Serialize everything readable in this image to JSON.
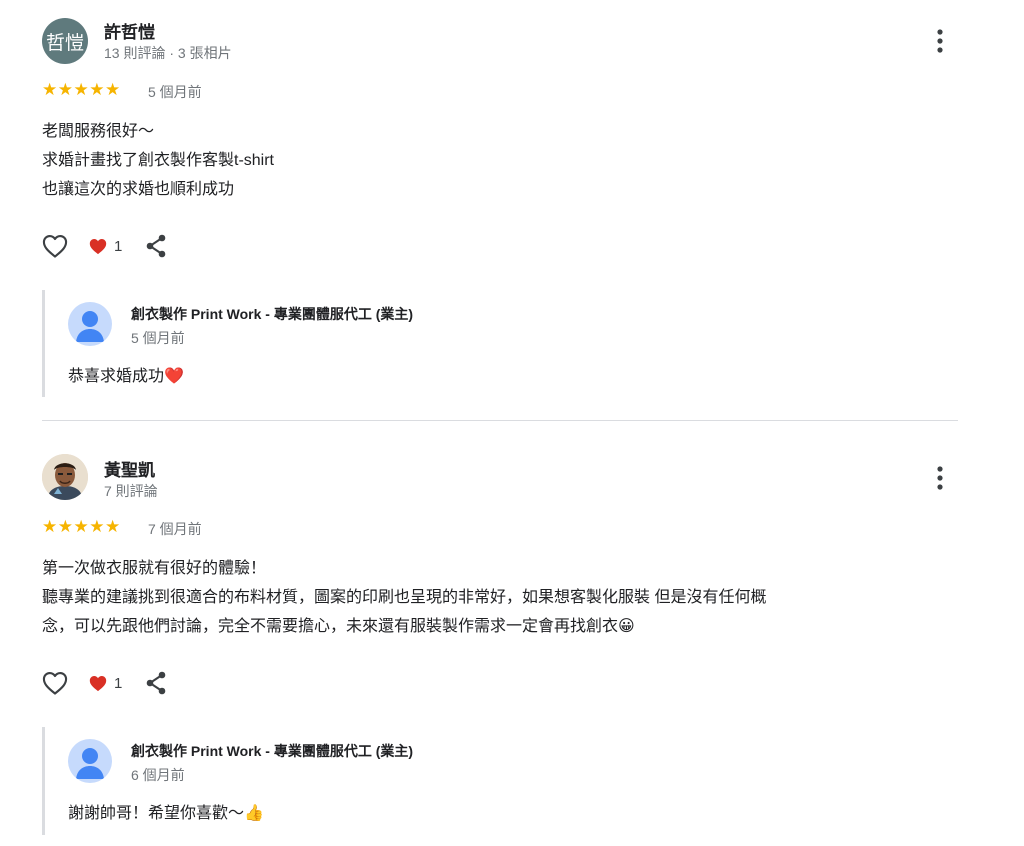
{
  "reviews": [
    {
      "avatar_initials": "哲愷",
      "name": "許哲愷",
      "meta": "13 則評論 · 3 張相片",
      "rating": 5,
      "stars": "★★★★★",
      "date": "5 個月前",
      "text": "老闆服務很好～\n求婚計畫找了創衣製作客製t-shirt\n也讓這次的求婚也順利成功",
      "reaction_count": "1",
      "reply": {
        "owner": "創衣製作 Print Work - 專業團體服代工 (業主)",
        "date": "5 個月前",
        "text": "恭喜求婚成功❤️"
      }
    },
    {
      "name": "黃聖凱",
      "meta": "7 則評論",
      "rating": 5,
      "stars": "★★★★★",
      "date": "7 個月前",
      "text": "第一次做衣服就有很好的體驗！\n聽專業的建議挑到很適合的布料材質，圖案的印刷也呈現的非常好，如果想客製化服裝 但是沒有任何概\n念，可以先跟他們討論，完全不需要擔心，未來還有服裝製作需求一定會再找創衣😀",
      "reaction_count": "1",
      "reply": {
        "owner": "創衣製作 Print Work - 專業團體服代工 (業主)",
        "date": "6 個月前",
        "text": "謝謝帥哥！希望你喜歡～👍"
      }
    }
  ],
  "colors": {
    "star": "#f6b400",
    "heart": "#d93025",
    "muted_text": "#70757a",
    "divider": "#dadce0",
    "reply_avatar": "#c6dafc",
    "reply_avatar_figure": "#4285f4",
    "initials_avatar": "#5f7a7d"
  },
  "icons": [
    "more-vert-icon",
    "like-heart-outline-icon",
    "red-heart-reaction-icon",
    "share-icon",
    "default-user-icon"
  ]
}
